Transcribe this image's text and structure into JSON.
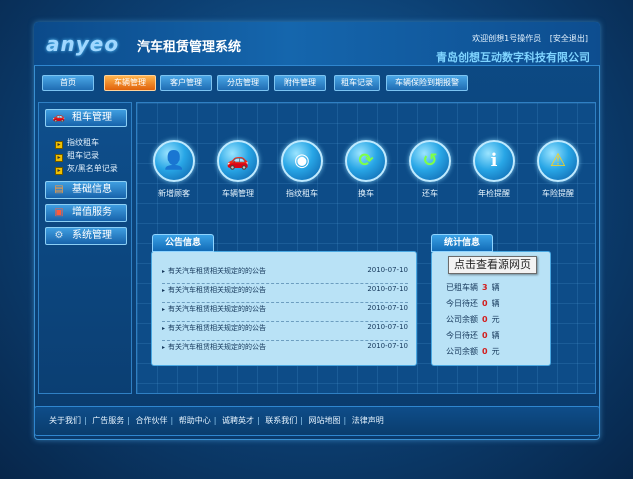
{
  "header": {
    "logo": "anyeo",
    "title": "汽车租赁管理系统",
    "welcome": "欢迎创想1号操作员",
    "logout": "[安全退出]",
    "company": "青岛创想互动数字科技有限公司"
  },
  "nav": {
    "items": [
      {
        "label": "首页"
      },
      {
        "label": "车辆管理",
        "active": true
      },
      {
        "label": "客户管理"
      },
      {
        "label": "分店管理"
      },
      {
        "label": "附件管理"
      },
      {
        "label": "租车记录"
      },
      {
        "label": "车辆保险到期报警"
      }
    ]
  },
  "sidebar": {
    "rental": {
      "label": "租车管理",
      "icon": "car-icon"
    },
    "sub_items": [
      {
        "label": "指纹租车"
      },
      {
        "label": "租车记录"
      },
      {
        "label": "灰/黑名单记录"
      }
    ],
    "basic": {
      "label": "基础信息",
      "icon": "database-icon"
    },
    "value_added": {
      "label": "增值服务",
      "icon": "gift-icon"
    },
    "system": {
      "label": "系统管理",
      "icon": "gear-icon"
    }
  },
  "tools": [
    {
      "label": "新增顾客",
      "icon": "user-icon",
      "glyph": "👤"
    },
    {
      "label": "车辆管理",
      "icon": "car-icon",
      "glyph": "🚗"
    },
    {
      "label": "指纹租车",
      "icon": "fingerprint-icon",
      "glyph": "◉"
    },
    {
      "label": "换车",
      "icon": "swap-icon",
      "glyph": "⟳"
    },
    {
      "label": "还车",
      "icon": "return-icon",
      "glyph": "↺"
    },
    {
      "label": "年检提醒",
      "icon": "info-icon",
      "glyph": "i"
    },
    {
      "label": "车险提醒",
      "icon": "warning-icon",
      "glyph": "⚠"
    }
  ],
  "notices": {
    "title": "公告信息",
    "rows": [
      {
        "text": "有关汽车租赁相关规定的的公告",
        "date": "2010-07-10"
      },
      {
        "text": "有关汽车租赁相关规定的的公告",
        "date": "2010-07-10"
      },
      {
        "text": "有关汽车租赁相关规定的的公告",
        "date": "2010-07-10"
      },
      {
        "text": "有关汽车租赁相关规定的的公告",
        "date": "2010-07-10"
      },
      {
        "text": "有关汽车租赁相关规定的的公告",
        "date": "2010-07-10"
      }
    ]
  },
  "stats": {
    "title": "统计信息",
    "tooltip": "点击查看源网页",
    "rows": [
      {
        "label": "已租车辆",
        "value": "3",
        "unit": "辆"
      },
      {
        "label": "今日待还",
        "value": "0",
        "unit": "辆"
      },
      {
        "label": "公司余额",
        "value": "0",
        "unit": "元"
      },
      {
        "label": "今日待还",
        "value": "0",
        "unit": "辆"
      },
      {
        "label": "公司余额",
        "value": "0",
        "unit": "元"
      }
    ]
  },
  "footer": {
    "links": [
      "关于我们",
      "广告服务",
      "合作伙伴",
      "帮助中心",
      "诚聘英才",
      "联系我们",
      "网站地图",
      "法律声明"
    ]
  }
}
